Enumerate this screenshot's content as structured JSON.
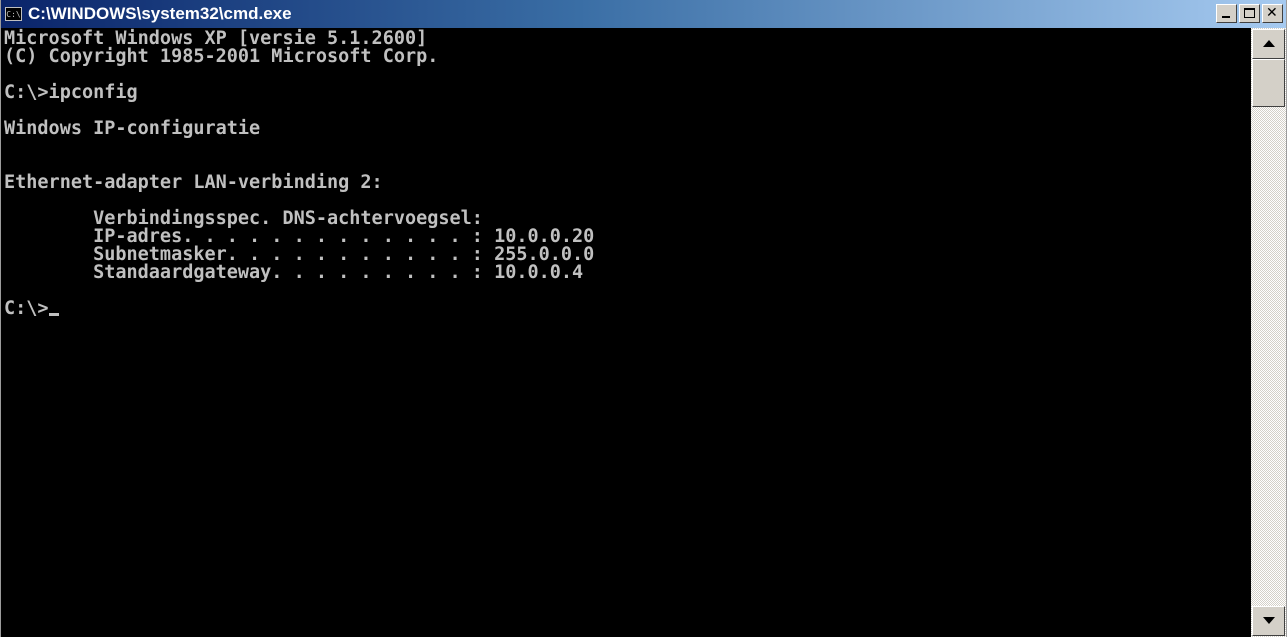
{
  "window": {
    "title": "C:\\WINDOWS\\system32\\cmd.exe",
    "icon_text": "C:\\",
    "icon": "console-icon"
  },
  "caption_buttons": {
    "minimize_icon": "minimize-icon",
    "maximize_icon": "maximize-icon",
    "close_icon": "close-icon",
    "close_glyph": "✕"
  },
  "console": {
    "lines": [
      "Microsoft Windows XP [versie 5.1.2600]",
      "(C) Copyright 1985-2001 Microsoft Corp.",
      "",
      "C:\\>ipconfig",
      "",
      "Windows IP-configuratie",
      "",
      "",
      "Ethernet-adapter LAN-verbinding 2:",
      "",
      "        Verbindingsspec. DNS-achtervoegsel:",
      "        IP-adres. . . . . . . . . . . . . : 10.0.0.20",
      "        Subnetmasker. . . . . . . . . . . : 255.0.0.0",
      "        Standaardgateway. . . . . . . . . : 10.0.0.4",
      ""
    ],
    "prompt": "C:\\>"
  },
  "colors": {
    "console_bg": "#000000",
    "console_fg": "#c0c0c0",
    "title_gradient_start": "#0a246a",
    "title_gradient_end": "#a6caf0"
  },
  "scrollbar": {
    "up_icon": "arrow-up-icon",
    "down_icon": "arrow-down-icon"
  }
}
